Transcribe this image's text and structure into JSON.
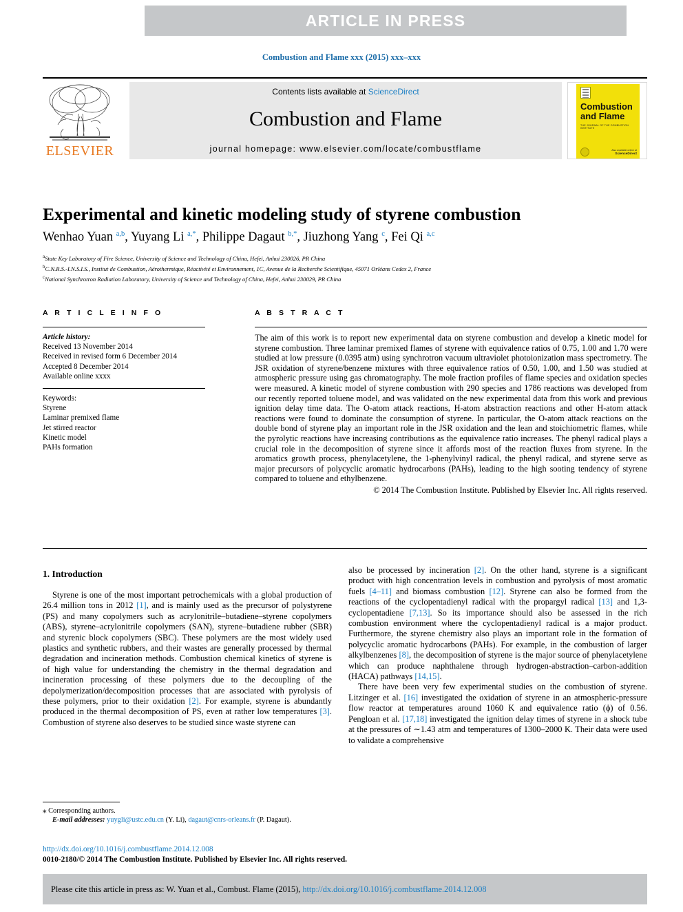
{
  "banner": {
    "label": "ARTICLE  IN  PRESS"
  },
  "journal_ref": "Combustion and Flame xxx (2015) xxx–xxx",
  "masthead": {
    "publisher": "ELSEVIER",
    "contents_prefix": "Contents lists available at ",
    "contents_link": "ScienceDirect",
    "journal_title": "Combustion and Flame",
    "homepage": "journal homepage: www.elsevier.com/locate/combustflame",
    "cover": {
      "title_line1": "Combustion",
      "title_line2": "and Flame",
      "subtitle": "THE JOURNAL OF THE COMBUSTION INSTITUTE",
      "footer_line1": "Also available online at",
      "footer_line2": "ScienceDirect"
    }
  },
  "article": {
    "title": "Experimental and kinetic modeling study of styrene combustion",
    "authors_html": "Wenhao Yuan <sup>a,b</sup>, Yuyang Li <sup>a,*</sup>, Philippe Dagaut <sup>b,*</sup>, Jiuzhong Yang <sup>c</sup>, Fei Qi <sup>a,c</sup>",
    "affiliations": [
      "State Key Laboratory of Fire Science, University of Science and Technology of China, Hefei, Anhui 230026, PR China",
      "C.N.R.S.-I.N.S.I.S., Institut de Combustion, Aérothermique, Réactivité et Environnement, 1C, Avenue de la Recherche Scientifique, 45071 Orléans Cedex 2, France",
      "National Synchrotron Radiation Laboratory, University of Science and Technology of China, Hefei, Anhui 230029, PR China"
    ],
    "affiliation_marks": [
      "a",
      "b",
      "c"
    ]
  },
  "article_info": {
    "heading": "A R T I C L E   I N F O",
    "history_label": "Article history:",
    "history": [
      "Received 13 November 2014",
      "Received in revised form 6 December 2014",
      "Accepted 8 December 2014",
      "Available online xxxx"
    ],
    "keywords_label": "Keywords:",
    "keywords": [
      "Styrene",
      "Laminar premixed flame",
      "Jet stirred reactor",
      "Kinetic model",
      "PAHs formation"
    ]
  },
  "abstract": {
    "heading": "A B S T R A C T",
    "text": "The aim of this work is to report new experimental data on styrene combustion and develop a kinetic model for styrene combustion. Three laminar premixed flames of styrene with equivalence ratios of 0.75, 1.00 and 1.70 were studied at low pressure (0.0395 atm) using synchrotron vacuum ultraviolet photoionization mass spectrometry. The JSR oxidation of styrene/benzene mixtures with three equivalence ratios of 0.50, 1.00, and 1.50 was studied at atmospheric pressure using gas chromatography. The mole fraction profiles of flame species and oxidation species were measured. A kinetic model of styrene combustion with 290 species and 1786 reactions was developed from our recently reported toluene model, and was validated on the new experimental data from this work and previous ignition delay time data. The O-atom attack reactions, H-atom abstraction reactions and other H-atom attack reactions were found to dominate the consumption of styrene. In particular, the O-atom attack reactions on the double bond of styrene play an important role in the JSR oxidation and the lean and stoichiometric flames, while the pyrolytic reactions have increasing contributions as the equivalence ratio increases. The phenyl radical plays a crucial role in the decomposition of styrene since it affords most of the reaction fluxes from styrene. In the aromatics growth process, phenylacetylene, the 1-phenylvinyl radical, the phenyl radical, and styrene serve as major precursors of polycyclic aromatic hydrocarbons (PAHs), leading to the high sooting tendency of styrene compared to toluene and ethylbenzene.",
    "copyright": "© 2014 The Combustion Institute. Published by Elsevier Inc. All rights reserved."
  },
  "body": {
    "section_heading": "1. Introduction",
    "left_paragraph_html": "Styrene is one of the most important petrochemicals with a global production of 26.4 million tons in 2012 <span class=\"ref\">[1]</span>, and is mainly used as the precursor of polystyrene (PS) and many copolymers such as acrylonitrile–butadiene–styrene copolymers (ABS), styrene–acrylonitrile copolymers (SAN), styrene–butadiene rubber (SBR) and styrenic block copolymers (SBC). These polymers are the most widely used plastics and synthetic rubbers, and their wastes are generally processed by thermal degradation and incineration methods. Combustion chemical kinetics of styrene is of high value for understanding the chemistry in the thermal degradation and incineration processing of these polymers due to the decoupling of the depolymerization/decomposition processes that are associated with pyrolysis of these polymers, prior to their oxidation <span class=\"ref\">[2]</span>. For example, styrene is abundantly produced in the thermal decomposition of PS, even at rather low temperatures <span class=\"ref\">[3]</span>. Combustion of styrene also deserves to be studied since waste styrene can",
    "right_paragraph1_html": "also be processed by incineration <span class=\"ref\">[2]</span>. On the other hand, styrene is a significant product with high concentration levels in combustion and pyrolysis of most aromatic fuels <span class=\"ref\">[4–11]</span> and biomass combustion <span class=\"ref\">[12]</span>. Styrene can also be formed from the reactions of the cyclopentadienyl radical with the propargyl radical <span class=\"ref\">[13]</span> and 1,3-cyclopentadiene <span class=\"ref\">[7,13]</span>. So its importance should also be assessed in the rich combustion environment where the cyclopentadienyl radical is a major product. Furthermore, the styrene chemistry also plays an important role in the formation of polycyclic aromatic hydrocarbons (PAHs). For example, in the combustion of larger alkylbenzenes <span class=\"ref\">[8]</span>, the decomposition of styrene is the major source of phenylacetylene which can produce naphthalene through hydrogen-abstraction–carbon-addition (HACA) pathways <span class=\"ref\">[14,15]</span>.",
    "right_paragraph2_html": "There have been very few experimental studies on the combustion of styrene. Litzinger et al. <span class=\"ref\">[16]</span> investigated the oxidation of styrene in an atmospheric-pressure flow reactor at temperatures around 1060 K and equivalence ratio (&#981;) of 0.56. Pengloan et al. <span class=\"ref\">[17,18]</span> investigated the ignition delay times of styrene in a shock tube at the pressures of ∼1.43 atm and temperatures of 1300–2000 K. Their data were used to validate a comprehensive"
  },
  "footnote": {
    "corresponding": "Corresponding authors.",
    "email_label": "E-mail addresses:",
    "email1": "yuygli@ustc.edu.cn",
    "email1_owner": "(Y. Li)",
    "email2": "dagaut@cnrs-orleans.fr",
    "email2_owner": "(P. Dagaut)."
  },
  "footer": {
    "doi": "http://dx.doi.org/10.1016/j.combustflame.2014.12.008",
    "issn": "0010-2180/© 2014 The Combustion Institute. Published by Elsevier Inc. All rights reserved.",
    "cite_prefix": "Please cite this article in press as: W. Yuan et al., Combust. Flame (2015), ",
    "cite_link": "http://dx.doi.org/10.1016/j.combustflame.2014.12.008"
  },
  "colors": {
    "banner_gray": "#c5c7c9",
    "link_blue": "#1b7fc4",
    "elsevier_orange": "#e87a22",
    "cover_yellow": "#f2e00a"
  }
}
